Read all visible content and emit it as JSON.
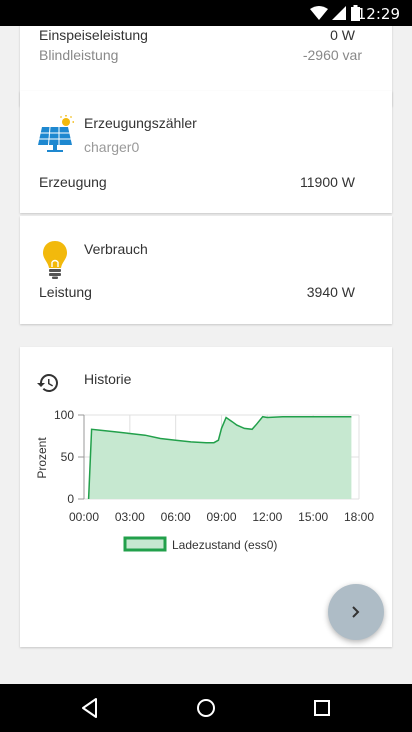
{
  "status_bar": {
    "time": "12:29"
  },
  "grid_card": {
    "rows": [
      {
        "label": "Einspeiseleistung",
        "value": "0 W"
      },
      {
        "label": "Blindleistung",
        "value": "-2960 var"
      }
    ]
  },
  "producer_card": {
    "title": "Erzeugungszähler",
    "subtitle": "charger0",
    "icon": "solar-panel-icon",
    "row": {
      "label": "Erzeugung",
      "value": "11900 W"
    }
  },
  "consumption_card": {
    "title": "Verbrauch",
    "icon": "lightbulb-icon",
    "row": {
      "label": "Leistung",
      "value": "3940 W"
    }
  },
  "history_card": {
    "title": "Historie",
    "icon": "history-icon"
  },
  "chart_data": {
    "type": "area",
    "title": "",
    "xlabel": "",
    "ylabel": "Prozent",
    "x_ticks": [
      "00:00",
      "03:00",
      "06:00",
      "09:00",
      "12:00",
      "15:00",
      "18:00"
    ],
    "y_ticks": [
      "0",
      "50",
      "100"
    ],
    "xlim": [
      0,
      18
    ],
    "ylim": [
      0,
      100
    ],
    "grid": true,
    "legend_position": "bottom",
    "series": [
      {
        "name": "Ladezustand (ess0)",
        "color": "#22a04b",
        "fill": "#c6e8d0",
        "x": [
          0.3,
          0.5,
          1.0,
          2.0,
          3.0,
          4.0,
          5.0,
          6.0,
          7.0,
          8.0,
          8.5,
          8.8,
          9.0,
          9.3,
          9.7,
          10.0,
          10.5,
          11.0,
          11.3,
          11.7,
          12.0,
          13.0,
          14.0,
          15.0,
          16.0,
          17.0,
          17.5
        ],
        "values": [
          0,
          83,
          82,
          80,
          78,
          76,
          72,
          70,
          68,
          67,
          67,
          70,
          84,
          97,
          92,
          88,
          84,
          83,
          89,
          98,
          97,
          98,
          98,
          98,
          98,
          98,
          98
        ]
      }
    ]
  },
  "fab": {
    "icon": "chevron-right-icon"
  },
  "nav_bar": {
    "back": "back-icon",
    "home": "home-icon",
    "recents": "recents-icon"
  }
}
